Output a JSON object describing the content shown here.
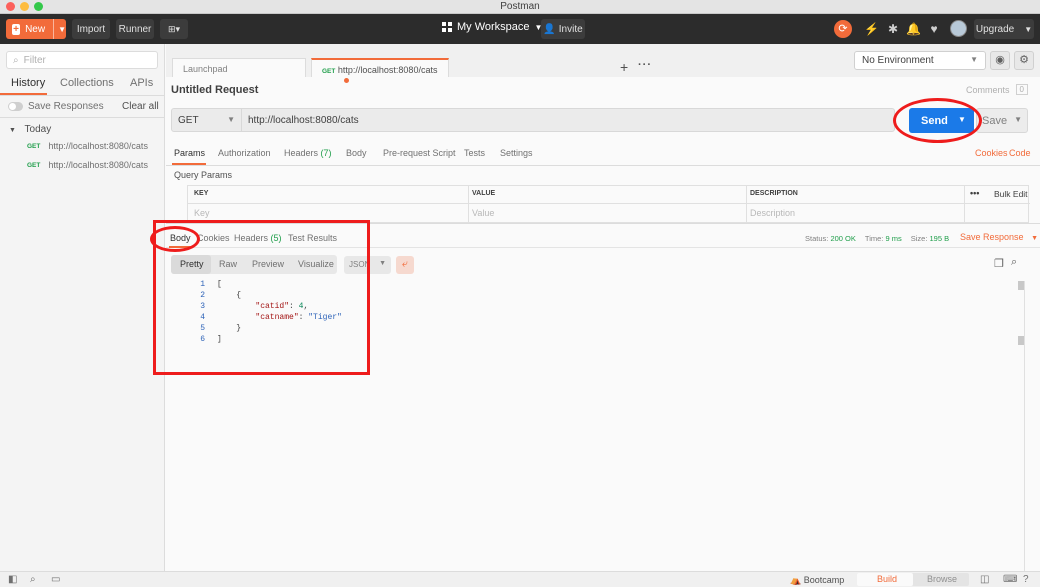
{
  "window": {
    "title": "Postman"
  },
  "header": {
    "new_label": "New",
    "import_label": "Import",
    "runner_label": "Runner",
    "workspace": "My Workspace",
    "invite": "Invite",
    "upgrade": "Upgrade"
  },
  "sidebar": {
    "filter_placeholder": "Filter",
    "tabs": [
      "History",
      "Collections",
      "APIs"
    ],
    "save_responses": "Save Responses",
    "clear_all": "Clear all",
    "group": "Today",
    "items": [
      {
        "method": "GET",
        "url": "http://localhost:8080/cats"
      },
      {
        "method": "GET",
        "url": "http://localhost:8080/cats"
      }
    ]
  },
  "tabs": {
    "launchpad": "Launchpad",
    "active_method": "GET",
    "active_url": "http://localhost:8080/cats"
  },
  "environment": "No Environment",
  "request": {
    "title": "Untitled Request",
    "comments": "Comments",
    "comments_count": "0",
    "method": "GET",
    "url": "http://localhost:8080/cats",
    "send": "Send",
    "save": "Save",
    "tabs": [
      "Params",
      "Authorization",
      "Headers",
      "Body",
      "Pre-request Script",
      "Tests",
      "Settings"
    ],
    "headers_count": "(7)",
    "cookies": "Cookies",
    "code": "Code",
    "query_params": "Query Params",
    "columns": [
      "KEY",
      "VALUE",
      "DESCRIPTION"
    ],
    "bulk_edit": "Bulk Edit",
    "placeholders": [
      "Key",
      "Value",
      "Description"
    ]
  },
  "response": {
    "tabs": [
      "Body",
      "Cookies",
      "Headers",
      "Test Results"
    ],
    "headers_count": "(5)",
    "status_label": "Status:",
    "status": "200 OK",
    "time_label": "Time:",
    "time": "9 ms",
    "size_label": "Size:",
    "size": "195 B",
    "save_response": "Save Response",
    "views": [
      "Pretty",
      "Raw",
      "Preview",
      "Visualize"
    ],
    "format": "JSON",
    "code": {
      "line_numbers": [
        "1",
        "2",
        "3",
        "4",
        "5",
        "6"
      ],
      "l1": "[",
      "l2": "    {",
      "key1": "\"catid\"",
      "val1": "4",
      "key2": "\"catname\"",
      "val2": "\"Tiger\"",
      "l5": "    }",
      "l6": "]"
    }
  },
  "footer": {
    "bootcamp": "Bootcamp",
    "build": "Build",
    "browse": "Browse"
  },
  "colors": {
    "accent": "#f26b3a",
    "send": "#1b7ae8",
    "annotation": "#ee1c1c",
    "success": "#1f9e4a"
  }
}
